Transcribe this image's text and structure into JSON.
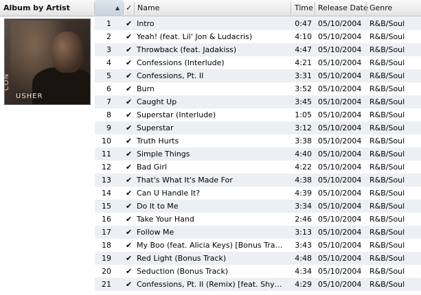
{
  "header": {
    "album_by_artist": "Album by Artist",
    "sort_indicator": "▲",
    "check": "✓",
    "name": "Name",
    "time": "Time",
    "release_date": "Release Date",
    "genre": "Genre"
  },
  "album": {
    "side_text": "CON",
    "artist_on_cover": "USHER"
  },
  "tracks": [
    {
      "num": "1",
      "checked": "✔",
      "name": "Intro",
      "time": "0:47",
      "release": "05/10/2004",
      "genre": "R&B/Soul"
    },
    {
      "num": "2",
      "checked": "✔",
      "name": "Yeah! (feat. Lil' Jon & Ludacris)",
      "time": "4:10",
      "release": "05/10/2004",
      "genre": "R&B/Soul"
    },
    {
      "num": "3",
      "checked": "✔",
      "name": "Throwback (feat. Jadakiss)",
      "time": "4:47",
      "release": "05/10/2004",
      "genre": "R&B/Soul"
    },
    {
      "num": "4",
      "checked": "✔",
      "name": "Confessions (Interlude)",
      "time": "4:21",
      "release": "05/10/2004",
      "genre": "R&B/Soul"
    },
    {
      "num": "5",
      "checked": "✔",
      "name": "Confessions, Pt. II",
      "time": "3:31",
      "release": "05/10/2004",
      "genre": "R&B/Soul"
    },
    {
      "num": "6",
      "checked": "✔",
      "name": "Burn",
      "time": "3:52",
      "release": "05/10/2004",
      "genre": "R&B/Soul"
    },
    {
      "num": "7",
      "checked": "✔",
      "name": "Caught Up",
      "time": "3:45",
      "release": "05/10/2004",
      "genre": "R&B/Soul"
    },
    {
      "num": "8",
      "checked": "✔",
      "name": "Superstar (Interlude)",
      "time": "1:05",
      "release": "05/10/2004",
      "genre": "R&B/Soul"
    },
    {
      "num": "9",
      "checked": "✔",
      "name": "Superstar",
      "time": "3:12",
      "release": "05/10/2004",
      "genre": "R&B/Soul"
    },
    {
      "num": "10",
      "checked": "✔",
      "name": "Truth Hurts",
      "time": "3:38",
      "release": "05/10/2004",
      "genre": "R&B/Soul"
    },
    {
      "num": "11",
      "checked": "✔",
      "name": "Simple Things",
      "time": "4:40",
      "release": "05/10/2004",
      "genre": "R&B/Soul"
    },
    {
      "num": "12",
      "checked": "✔",
      "name": "Bad Girl",
      "time": "4:22",
      "release": "05/10/2004",
      "genre": "R&B/Soul"
    },
    {
      "num": "13",
      "checked": "✔",
      "name": "That's What It's Made For",
      "time": "4:38",
      "release": "05/10/2004",
      "genre": "R&B/Soul"
    },
    {
      "num": "14",
      "checked": "✔",
      "name": "Can U Handle It?",
      "time": "4:39",
      "release": "05/10/2004",
      "genre": "R&B/Soul"
    },
    {
      "num": "15",
      "checked": "✔",
      "name": "Do It to Me",
      "time": "3:34",
      "release": "05/10/2004",
      "genre": "R&B/Soul"
    },
    {
      "num": "16",
      "checked": "✔",
      "name": "Take Your Hand",
      "time": "2:46",
      "release": "05/10/2004",
      "genre": "R&B/Soul"
    },
    {
      "num": "17",
      "checked": "✔",
      "name": "Follow Me",
      "time": "3:13",
      "release": "05/10/2004",
      "genre": "R&B/Soul"
    },
    {
      "num": "18",
      "checked": "✔",
      "name": "My Boo (feat. Alicia Keys) [Bonus Track]",
      "time": "3:43",
      "release": "05/10/2004",
      "genre": "R&B/Soul"
    },
    {
      "num": "19",
      "checked": "✔",
      "name": "Red Light (Bonus Track)",
      "time": "4:48",
      "release": "05/10/2004",
      "genre": "R&B/Soul"
    },
    {
      "num": "20",
      "checked": "✔",
      "name": "Seduction (Bonus Track)",
      "time": "4:34",
      "release": "05/10/2004",
      "genre": "R&B/Soul"
    },
    {
      "num": "21",
      "checked": "✔",
      "name": "Confessions, Pt. II (Remix) [feat. Shyne, T...",
      "time": "4:29",
      "release": "05/10/2004",
      "genre": "R&B/Soul"
    }
  ]
}
